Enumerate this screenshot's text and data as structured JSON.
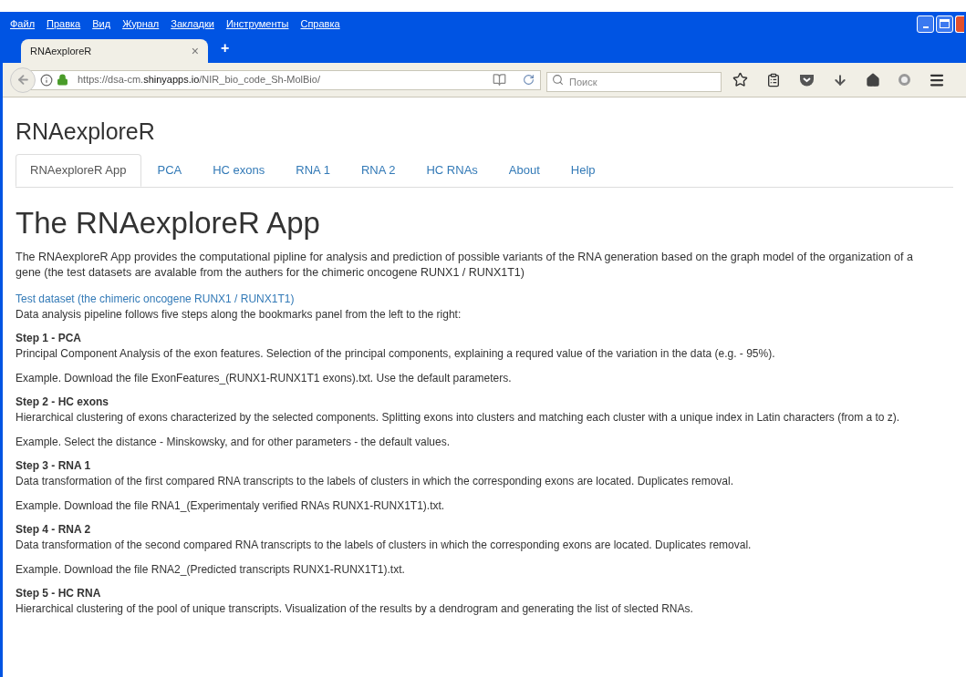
{
  "menu": [
    "Файл",
    "Правка",
    "Вид",
    "Журнал",
    "Закладки",
    "Инструменты",
    "Справка"
  ],
  "browser_tab": {
    "title": "RNAexploreR",
    "close": "×",
    "new_tab": "+"
  },
  "address": {
    "prefix": "https://dsa-cm.",
    "domain": "shinyapps.io",
    "suffix": "/NIR_bio_code_Sh-MolBio/"
  },
  "search": {
    "placeholder": "Поиск"
  },
  "app_title": "RNAexploreR",
  "tabs": [
    {
      "label": "RNAexploreR App",
      "selected": true
    },
    {
      "label": "PCA",
      "selected": false
    },
    {
      "label": "HC exons",
      "selected": false
    },
    {
      "label": "RNA 1",
      "selected": false
    },
    {
      "label": "RNA 2",
      "selected": false
    },
    {
      "label": "HC RNAs",
      "selected": false
    },
    {
      "label": "About",
      "selected": false
    },
    {
      "label": "Help",
      "selected": false
    }
  ],
  "heading": "The RNAexploreR App",
  "intro": "The RNAexploreR App provides the computational pipline for analysis and prediction of possible variants of the RNA generation based on the graph model of the organization of a gene (the test datasets are avalable from the authers for the chimeric oncogene RUNX1 / RUNX1T1)",
  "link": "Test dataset (the chimeric oncogene RUNX1 / RUNX1T1)",
  "pipeline": "Data analysis pipeline follows five steps along the bookmarks panel from the left to the right:",
  "steps": [
    {
      "title": "Step 1 - PCA",
      "description": "Principal Component Analysis of the exon features. Selection of the principal components, explaining a requred value of the variation in the data (e.g. - 95%).",
      "example": "Example. Download the file ExonFeatures_(RUNX1-RUNX1T1 exons).txt. Use the default parameters."
    },
    {
      "title": "Step 2 - HC exons",
      "description": "Hierarchical clustering of exons characterized by the selected components. Splitting exons into clusters and matching each cluster with a unique index in Latin characters (from a to z).",
      "example": "Example. Select the distance - Minskowsky, and for other parameters - the default values."
    },
    {
      "title": "Step 3 - RNA 1",
      "description": "Data transformation of the first compared RNA transcripts to the labels of clusters in which the corresponding exons are located. Duplicates removal.",
      "example": "Example. Download the file RNA1_(Experimentaly verified RNAs RUNX1-RUNX1T1).txt."
    },
    {
      "title": "Step 4 - RNA 2",
      "description": "Data transformation of the second compared RNA transcripts to the labels of clusters in which the corresponding exons are located. Duplicates removal.",
      "example": "Example. Download the file RNA2_(Predicted transcripts RUNX1-RUNX1T1).txt."
    },
    {
      "title": "Step 5 - HC RNA",
      "description": "Hierarchical clustering of the pool of unique transcripts. Visualization of the results by a dendrogram and generating the list of slected RNAs."
    }
  ]
}
